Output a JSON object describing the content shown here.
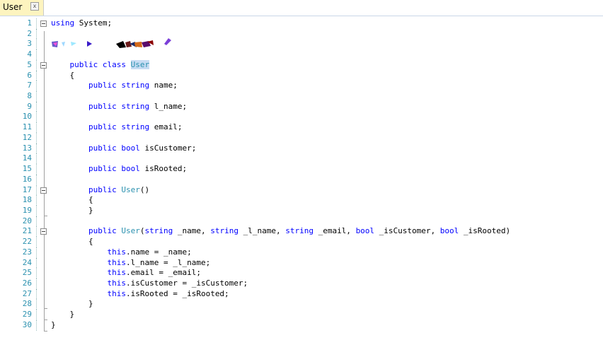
{
  "tab": {
    "title": "User",
    "close": "x"
  },
  "lines": [
    {
      "n": "1",
      "fold": true,
      "parts": [
        {
          "t": "using",
          "c": "kw"
        },
        {
          "t": " System;"
        }
      ]
    },
    {
      "n": "2",
      "parts": []
    },
    {
      "n": "3",
      "parts": [],
      "redacted": true
    },
    {
      "n": "4",
      "parts": []
    },
    {
      "n": "5",
      "fold": true,
      "parts": [
        {
          "t": "    "
        },
        {
          "t": "public",
          "c": "kw"
        },
        {
          "t": " "
        },
        {
          "t": "class",
          "c": "kw"
        },
        {
          "t": " "
        },
        {
          "t": "User",
          "c": "ty sel"
        }
      ]
    },
    {
      "n": "6",
      "parts": [
        {
          "t": "    {"
        }
      ]
    },
    {
      "n": "7",
      "parts": [
        {
          "t": "        "
        },
        {
          "t": "public",
          "c": "kw"
        },
        {
          "t": " "
        },
        {
          "t": "string",
          "c": "kw"
        },
        {
          "t": " name;"
        }
      ]
    },
    {
      "n": "8",
      "parts": []
    },
    {
      "n": "9",
      "parts": [
        {
          "t": "        "
        },
        {
          "t": "public",
          "c": "kw"
        },
        {
          "t": " "
        },
        {
          "t": "string",
          "c": "kw"
        },
        {
          "t": " l_name;"
        }
      ]
    },
    {
      "n": "10",
      "parts": []
    },
    {
      "n": "11",
      "parts": [
        {
          "t": "        "
        },
        {
          "t": "public",
          "c": "kw"
        },
        {
          "t": " "
        },
        {
          "t": "string",
          "c": "kw"
        },
        {
          "t": " email;"
        }
      ]
    },
    {
      "n": "12",
      "parts": []
    },
    {
      "n": "13",
      "parts": [
        {
          "t": "        "
        },
        {
          "t": "public",
          "c": "kw"
        },
        {
          "t": " "
        },
        {
          "t": "bool",
          "c": "kw"
        },
        {
          "t": " isCustomer;"
        }
      ]
    },
    {
      "n": "14",
      "parts": []
    },
    {
      "n": "15",
      "parts": [
        {
          "t": "        "
        },
        {
          "t": "public",
          "c": "kw"
        },
        {
          "t": " "
        },
        {
          "t": "bool",
          "c": "kw"
        },
        {
          "t": " isRooted;"
        }
      ]
    },
    {
      "n": "16",
      "parts": []
    },
    {
      "n": "17",
      "fold": true,
      "parts": [
        {
          "t": "        "
        },
        {
          "t": "public",
          "c": "kw"
        },
        {
          "t": " "
        },
        {
          "t": "User",
          "c": "ty"
        },
        {
          "t": "()"
        }
      ]
    },
    {
      "n": "18",
      "parts": [
        {
          "t": "        {"
        }
      ]
    },
    {
      "n": "19",
      "parts": [
        {
          "t": "        }"
        }
      ]
    },
    {
      "n": "20",
      "parts": []
    },
    {
      "n": "21",
      "fold": true,
      "parts": [
        {
          "t": "        "
        },
        {
          "t": "public",
          "c": "kw"
        },
        {
          "t": " "
        },
        {
          "t": "User",
          "c": "ty"
        },
        {
          "t": "("
        },
        {
          "t": "string",
          "c": "kw"
        },
        {
          "t": " _name, "
        },
        {
          "t": "string",
          "c": "kw"
        },
        {
          "t": " _l_name, "
        },
        {
          "t": "string",
          "c": "kw"
        },
        {
          "t": " _email, "
        },
        {
          "t": "bool",
          "c": "kw"
        },
        {
          "t": " _isCustomer, "
        },
        {
          "t": "bool",
          "c": "kw"
        },
        {
          "t": " _isRooted)"
        }
      ]
    },
    {
      "n": "22",
      "parts": [
        {
          "t": "        {"
        }
      ]
    },
    {
      "n": "23",
      "parts": [
        {
          "t": "            "
        },
        {
          "t": "this",
          "c": "kw"
        },
        {
          "t": ".name = _name;"
        }
      ]
    },
    {
      "n": "24",
      "parts": [
        {
          "t": "            "
        },
        {
          "t": "this",
          "c": "kw"
        },
        {
          "t": ".l_name = _l_name;"
        }
      ]
    },
    {
      "n": "25",
      "parts": [
        {
          "t": "            "
        },
        {
          "t": "this",
          "c": "kw"
        },
        {
          "t": ".email = _email;"
        }
      ]
    },
    {
      "n": "26",
      "parts": [
        {
          "t": "            "
        },
        {
          "t": "this",
          "c": "kw"
        },
        {
          "t": ".isCustomer = _isCustomer;"
        }
      ]
    },
    {
      "n": "27",
      "parts": [
        {
          "t": "            "
        },
        {
          "t": "this",
          "c": "kw"
        },
        {
          "t": ".isRooted = _isRooted;"
        }
      ]
    },
    {
      "n": "28",
      "parts": [
        {
          "t": "        }"
        }
      ]
    },
    {
      "n": "29",
      "parts": [
        {
          "t": "    }"
        }
      ]
    },
    {
      "n": "30",
      "parts": [
        {
          "t": "}"
        }
      ]
    }
  ],
  "colors": {
    "keyword": "#0000ff",
    "type": "#2b91af",
    "line_number": "#2b91af",
    "selection": "#c7dcf3",
    "tab_active": "#fdf4bf"
  }
}
